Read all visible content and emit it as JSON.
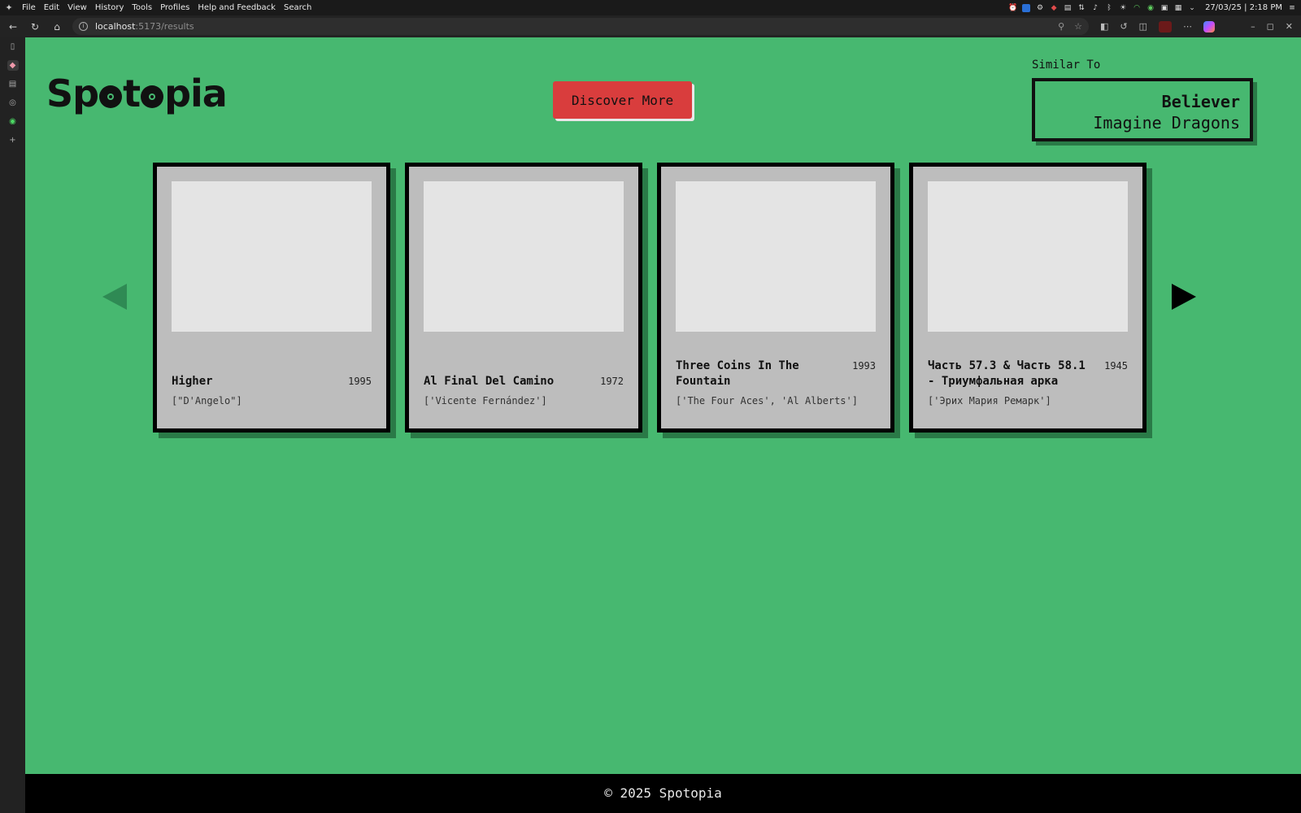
{
  "os_menubar": {
    "items": [
      "File",
      "Edit",
      "View",
      "History",
      "Tools",
      "Profiles",
      "Help and Feedback",
      "Search"
    ],
    "clock": "27/03/25 | 2:18 PM"
  },
  "browser": {
    "url_host": "localhost",
    "url_path": ":5173/results"
  },
  "app": {
    "brand": "Spotopia",
    "discover_label": "Discover More",
    "similar_label": "Similar To",
    "similar_song": "Believer",
    "similar_artist": "Imagine Dragons",
    "footer": "© 2025 Spotopia"
  },
  "cards": [
    {
      "title": "Higher",
      "year": "1995",
      "artists": "[\"D'Angelo\"]"
    },
    {
      "title": "Al Final Del Camino",
      "year": "1972",
      "artists": "['Vicente Fernández']"
    },
    {
      "title": "Three Coins In The Fountain",
      "year": "1993",
      "artists": "['The Four Aces', 'Al Alberts']"
    },
    {
      "title": "Часть 57.3 & Часть 58.1 - Триумфальная арка",
      "year": "1945",
      "artists": "['Эрих Мария Ремарк']"
    }
  ],
  "colors": {
    "background": "#47b870",
    "accent_button": "#d93d3d",
    "card": "#bdbdbd",
    "cover_placeholder": "#e4e4e4",
    "footer": "#000000"
  }
}
